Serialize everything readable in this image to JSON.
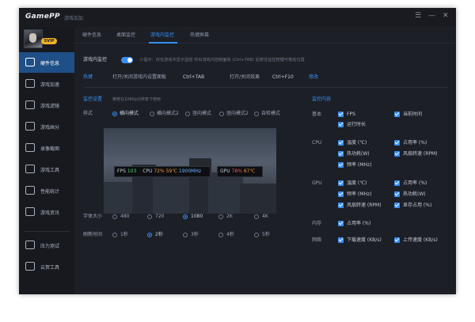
{
  "app": {
    "logo": "GamePP",
    "subtitle": "游戏加加"
  },
  "window_controls": {
    "menu": "☰",
    "minimize": "—",
    "close": "✕"
  },
  "user": {
    "badge": "SVIP"
  },
  "sidebar": {
    "items": [
      {
        "label": "硬件信息",
        "icon": "chip-icon"
      },
      {
        "label": "游戏加速",
        "icon": "speed-icon"
      },
      {
        "label": "游戏滤镜",
        "icon": "filter-icon"
      },
      {
        "label": "游戏画分",
        "icon": "score-icon"
      },
      {
        "label": "录像截图",
        "icon": "camera-icon"
      },
      {
        "label": "游戏工具",
        "icon": "toolbox-icon"
      },
      {
        "label": "性能统计",
        "icon": "stats-icon"
      },
      {
        "label": "游戏资讯",
        "icon": "news-icon"
      },
      {
        "label": "压力测试",
        "icon": "stress-icon"
      },
      {
        "label": "云贺工具",
        "icon": "cloud-icon"
      }
    ]
  },
  "tabs": [
    "硬件信息",
    "桌面监控",
    "游戏内监控",
    "热键屏幕"
  ],
  "monitor": {
    "label": "游戏内监控",
    "tip": "小提示：仅在游戏中显示监控 呼出游戏内控制面板 (Ctrl+TAB) 后按住监控按键可拖动位置"
  },
  "hotkeys": {
    "label": "热键",
    "open_panel_label": "打开/关闭游戏内设置面板",
    "open_panel_key": "Ctrl+TAB",
    "toggle_label": "打开/关闭效果",
    "toggle_key": "Ctrl+F10",
    "modify": "修改"
  },
  "settings": {
    "label": "监控设置",
    "hint": "推荐在1080p分辨率下使用"
  },
  "style": {
    "label": "样式",
    "options": [
      "横向模式",
      "横向模式2",
      "竖向模式",
      "竖向模式2",
      "自检模式"
    ],
    "selected": "横向模式"
  },
  "osd": {
    "fps_label": "FPS",
    "fps": "103",
    "cpu_label": "CPU",
    "cpu_usage": "72%",
    "cpu_temp": "59℃",
    "cpu_clock": "1900MHz",
    "gpu_label": "GPU",
    "gpu_usage": "78%",
    "gpu_temp": "67℃"
  },
  "font_size": {
    "label": "字体大小",
    "options": [
      "480",
      "720",
      "1080",
      "2K",
      "4K"
    ],
    "selected": "1080"
  },
  "refresh": {
    "label": "刷新时间",
    "options": [
      "1秒",
      "2秒",
      "3秒",
      "4秒",
      "5秒"
    ],
    "selected": "2秒"
  },
  "content": {
    "label": "监控内容",
    "groups": [
      {
        "name": "基本",
        "items": [
          "FPS",
          "当前时间",
          "运行时长"
        ]
      },
      {
        "name": "CPU",
        "items": [
          "温度 (℃)",
          "占用率 (%)",
          "热功耗(W)",
          "风扇转速 (RPM)",
          "频率 (MHz)"
        ]
      },
      {
        "name": "GPU",
        "items": [
          "温度 (℃)",
          "占用率 (%)",
          "频率 (MHz)",
          "热功耗(W)",
          "风扇转速 (RPM)",
          "显存占用 (%)"
        ]
      },
      {
        "name": "内存",
        "items": [
          "占用率 (%)"
        ]
      },
      {
        "name": "网络",
        "items": [
          "下载速度 (KB/s)",
          "上传速度 (KB/s)"
        ]
      }
    ]
  },
  "colors": {
    "accent": "#3a8ff6",
    "background": "#1c1f26",
    "sidebar_active": "#1e4f86",
    "fps_green": "#4cd964",
    "cpu_orange": "#f0963a",
    "gpu_red": "#f05a5a",
    "clock_blue": "#6fb6ff"
  }
}
